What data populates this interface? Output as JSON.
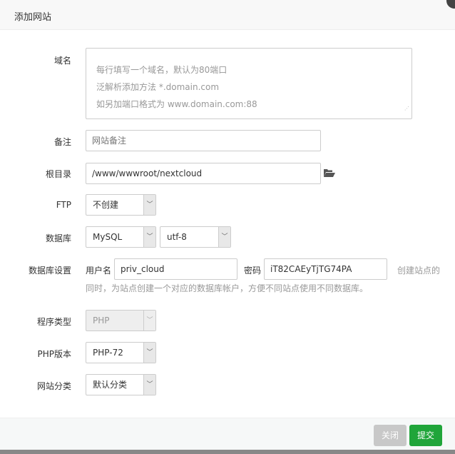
{
  "dialog": {
    "title": "添加网站"
  },
  "form": {
    "domain": {
      "label": "域名",
      "placeholder_lines": [
        "每行填写一个域名，默认为80端口",
        "泛解析添加方法 *.domain.com",
        "如另加端口格式为 www.domain.com:88"
      ]
    },
    "remark": {
      "label": "备注",
      "placeholder": "网站备注"
    },
    "root": {
      "label": "根目录",
      "value": "/www/wwwroot/nextcloud",
      "icon": "folder-open-icon"
    },
    "ftp": {
      "label": "FTP",
      "value": "不创建"
    },
    "database": {
      "label": "数据库",
      "type": "MySQL",
      "charset": "utf-8"
    },
    "db_settings": {
      "label": "数据库设置",
      "user_label": "用户名",
      "user": "priv_cloud",
      "pass_label": "密码",
      "pass": "iT82CAEyTjTG74PA",
      "hint1": "创建站点的",
      "hint2": "同时，为站点创建一个对应的数据库帐户，方便不同站点使用不同数据库。"
    },
    "program_type": {
      "label": "程序类型",
      "value": "PHP"
    },
    "php_version": {
      "label": "PHP版本",
      "value": "PHP-72"
    },
    "category": {
      "label": "网站分类",
      "value": "默认分类"
    }
  },
  "footer": {
    "close": "关闭",
    "submit": "提交"
  },
  "colors": {
    "submit": "#20a53a",
    "close": "#c8c8c8"
  }
}
